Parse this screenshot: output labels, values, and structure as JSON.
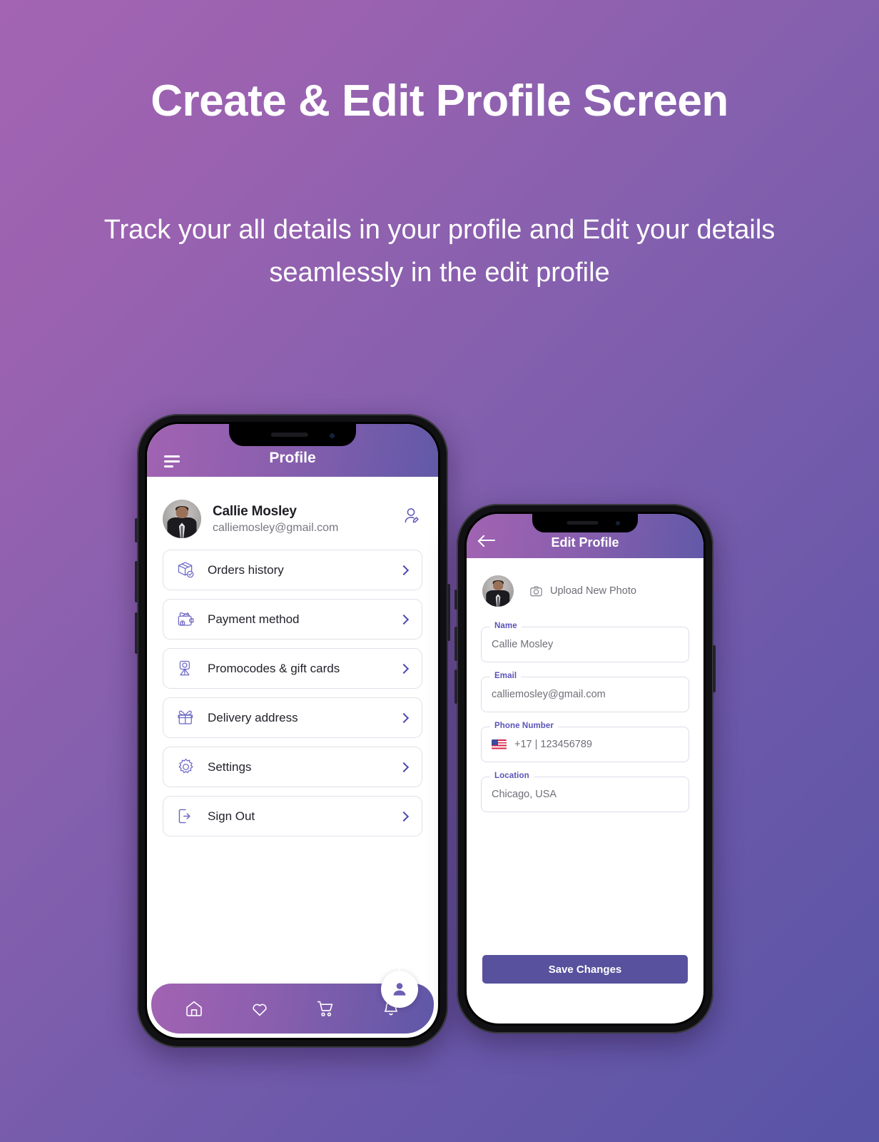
{
  "page": {
    "headline": "Create & Edit Profile Screen",
    "subheadline": "Track your all details in your profile and Edit your details seamlessly in the edit profile",
    "background_gradient_from": "#a264b3",
    "background_gradient_to": "#5854a6"
  },
  "profile_screen": {
    "header": {
      "title": "Profile",
      "menu_icon": "hamburger-icon",
      "gradient_from": "#a263b2",
      "gradient_to": "#6159a8"
    },
    "user": {
      "name": "Callie Mosley",
      "email": "calliemosley@gmail.com",
      "avatar_icon": "user-avatar-photo",
      "edit_icon": "edit-profile-icon"
    },
    "menu": [
      {
        "label": "Orders history",
        "icon": "package-box-icon"
      },
      {
        "label": "Payment method",
        "icon": "wallet-icon"
      },
      {
        "label": "Promocodes & gift cards",
        "icon": "location-pin-icon"
      },
      {
        "label": "Delivery address",
        "icon": "gift-box-icon"
      },
      {
        "label": "Settings",
        "icon": "gear-icon"
      },
      {
        "label": "Sign Out",
        "icon": "logout-icon"
      }
    ],
    "bottom_nav": [
      {
        "name": "home",
        "icon": "home-icon",
        "active": false
      },
      {
        "name": "favorites",
        "icon": "heart-icon",
        "active": false
      },
      {
        "name": "cart",
        "icon": "shopping-cart-icon",
        "active": false
      },
      {
        "name": "notifications",
        "icon": "bell-icon",
        "active": false
      },
      {
        "name": "profile",
        "icon": "person-icon",
        "active": true
      }
    ],
    "accent_color": "#4b4bb0"
  },
  "edit_screen": {
    "header": {
      "title": "Edit Profile",
      "back_icon": "back-arrow-icon"
    },
    "upload": {
      "label": "Upload New Photo",
      "icon": "camera-icon",
      "avatar_icon": "user-avatar-photo"
    },
    "fields": [
      {
        "label": "Name",
        "value": "Callie Mosley"
      },
      {
        "label": "Email",
        "value": "calliemosley@gmail.com"
      },
      {
        "label": "Phone Number",
        "value": "+17 | 123456789",
        "flag": "us-flag-icon"
      },
      {
        "label": "Location",
        "value": "Chicago, USA"
      }
    ],
    "save_button": "Save Changes",
    "save_button_color": "#57519e",
    "label_color": "#5a53b8"
  }
}
